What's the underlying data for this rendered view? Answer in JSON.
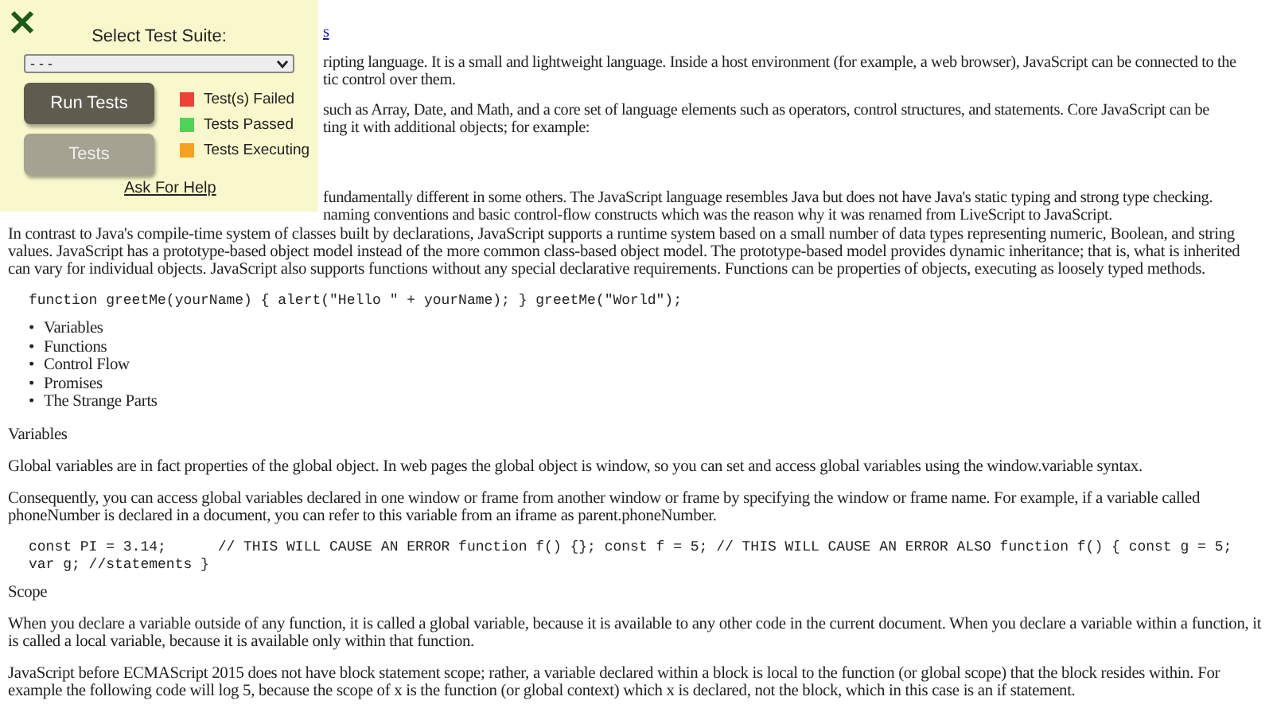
{
  "test_panel": {
    "title": "Select Test Suite:",
    "suite_select": {
      "value": "- - -"
    },
    "buttons": [
      {
        "label": "Run Tests",
        "disabled": false
      },
      {
        "label": "Tests",
        "disabled": true
      }
    ],
    "legend": [
      {
        "label": "Test(s) Failed",
        "color": "#ef4136"
      },
      {
        "label": "Tests Passed",
        "color": "#4fd45a"
      },
      {
        "label": "Tests Executing",
        "color": "#f6a21f"
      }
    ],
    "help_link": "Ask For Help"
  },
  "document": {
    "visible_fragments": [
      {
        "lines": [
          {
            "kind": "link",
            "text": "s"
          }
        ]
      },
      {
        "lines": [
          {
            "kind": "text",
            "text": "ripting language. It is a small and lightweight language. Inside a host environment (for example, a web browser), JavaScript can be connected to the"
          },
          {
            "kind": "text",
            "text": "tic control over them."
          }
        ]
      },
      {
        "lines": [
          {
            "kind": "text",
            "text": "such as Array, Date, and Math, and a core set of language elements such as operators, control structures, and statements. Core JavaScript can be"
          },
          {
            "kind": "text",
            "text": "ting it with additional objects; for example:"
          }
        ]
      },
      {
        "lines": [
          {
            "kind": "text",
            "text": "fundamentally different in some others. The JavaScript language resembles Java but does not have Java's static typing and strong type checking."
          },
          {
            "kind": "text",
            "text": "naming conventions and basic control-flow constructs which was the reason why it was renamed from LiveScript to JavaScript."
          }
        ]
      }
    ],
    "blocks": [
      {
        "kind": "paragraph",
        "text": "In contrast to Java's compile-time system of classes built by declarations, JavaScript supports a runtime system based on a small number of data types representing numeric, Boolean, and string values. JavaScript has a prototype-based object model instead of the more common class-based object model. The prototype-based model provides dynamic inheritance; that is, what is inherited can vary for individual objects. JavaScript also supports functions without any special declarative requirements. Functions can be properties of objects, executing as loosely typed methods."
      },
      {
        "kind": "code",
        "text": "function greetMe(yourName) { alert(\"Hello \" + yourName); } greetMe(\"World\");"
      },
      {
        "kind": "list",
        "items": [
          {
            "marker": "•",
            "text": "Variables"
          },
          {
            "marker": "•",
            "text": "Functions"
          },
          {
            "marker": "•",
            "text": "Control Flow"
          },
          {
            "marker": "•",
            "text": "Promises"
          },
          {
            "marker": "•",
            "text": "The Strange Parts"
          }
        ]
      },
      {
        "kind": "heading",
        "text": "Variables"
      },
      {
        "kind": "paragraph",
        "text": "Global variables are in fact properties of the global object. In web pages the global object is window, so you can set and access global variables using the window.variable syntax."
      },
      {
        "kind": "paragraph",
        "text": "Consequently, you can access global variables declared in one window or frame from another window or frame by specifying the window or frame name. For example, if a variable called phoneNumber is declared in a document, you can refer to this variable from an iframe as parent.phoneNumber."
      },
      {
        "kind": "code",
        "text": "const PI = 3.14;      // THIS WILL CAUSE AN ERROR function f() {}; const f = 5; // THIS WILL CAUSE AN ERROR ALSO function f() { const g = 5; var g; //statements }"
      },
      {
        "kind": "heading",
        "text": "Scope"
      },
      {
        "kind": "paragraph",
        "text": "When you declare a variable outside of any function, it is called a global variable, because it is available to any other code in the current document. When you declare a variable within a function, it is called a local variable, because it is available only within that function."
      },
      {
        "kind": "paragraph",
        "text": "JavaScript before ECMAScript 2015 does not have block statement scope; rather, a variable declared within a block is local to the function (or global scope) that the block resides within. For example the following code will log 5, because the scope of x is the function (or global context) which x is declared, not the block, which in this case is an if statement."
      }
    ]
  }
}
